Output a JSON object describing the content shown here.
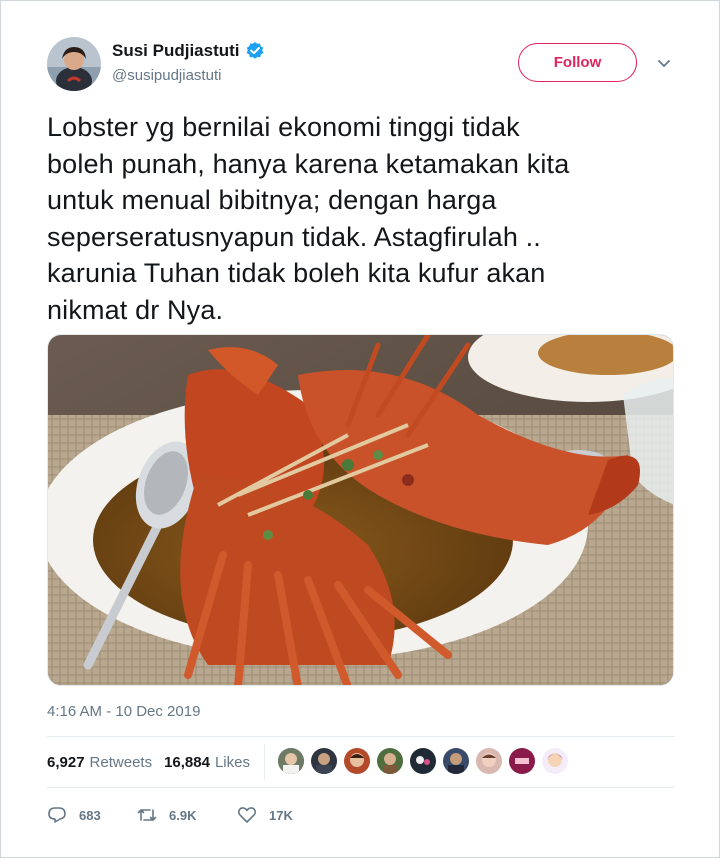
{
  "tweet": {
    "author": {
      "display_name": "Susi Pudjiastuti",
      "handle": "@susipudjiastuti",
      "verified": true
    },
    "follow_label": "Follow",
    "text": "Lobster yg bernilai ekonomi tinggi tidak\nboleh punah, hanya karena ketamakan kita\nuntuk menual bibitnya; dengan harga\nseperseratusnyapun tidak. Astagfirulah ..\nkarunia Tuhan tidak boleh kita kufur akan\nnikmat dr Nya.",
    "timestamp": "4:16 AM - 10 Dec 2019",
    "stats": {
      "retweets_count": "6,927",
      "retweets_label": "Retweets",
      "likes_count": "16,884",
      "likes_label": "Likes"
    },
    "liker_avatar_count": 9,
    "actions": {
      "replies": "683",
      "retweets": "6.9K",
      "likes": "17K"
    }
  },
  "colors": {
    "follow_accent": "#e0245e",
    "verified_blue": "#1da1f2",
    "muted_text": "#657786"
  },
  "icons": [
    "verified-badge-icon",
    "chevron-down-icon",
    "reply-icon",
    "retweet-icon",
    "like-heart-icon"
  ]
}
